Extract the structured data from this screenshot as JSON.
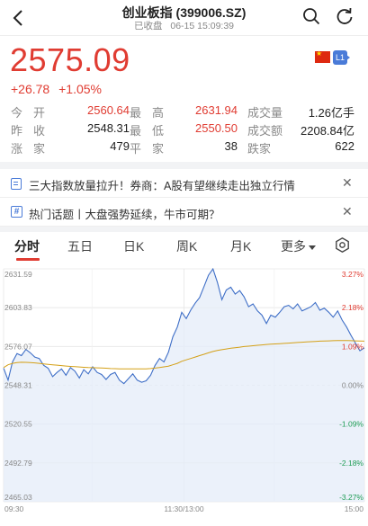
{
  "header": {
    "title": "创业板指 (399006.SZ)",
    "status": "已收盘",
    "datetime": "06-15 15:09:39"
  },
  "quote": {
    "price": "2575.09",
    "change": "+26.78",
    "change_pct": "+1.05%",
    "badge": "L1"
  },
  "stats": [
    [
      {
        "label": "今开",
        "value": "2560.64",
        "color": "red"
      },
      {
        "label": "最高",
        "value": "2631.94",
        "color": "red"
      },
      {
        "label": "成交量",
        "value": "1.26亿手",
        "color": "normal"
      }
    ],
    [
      {
        "label": "昨收",
        "value": "2548.31",
        "color": "normal"
      },
      {
        "label": "最低",
        "value": "2550.50",
        "color": "red"
      },
      {
        "label": "成交额",
        "value": "2208.84亿",
        "color": "normal"
      }
    ],
    [
      {
        "label": "涨家",
        "value": "479",
        "color": "normal"
      },
      {
        "label": "平家",
        "value": "38",
        "color": "normal"
      },
      {
        "label": "跌家",
        "value": "622",
        "color": "normal"
      }
    ]
  ],
  "news": [
    {
      "text": "三大指数放量拉升！券商：A股有望继续走出独立行情"
    },
    {
      "text": "热门话题丨大盘强势延续，牛市可期？"
    }
  ],
  "tabs": [
    "分时",
    "五日",
    "日K",
    "周K",
    "月K",
    "更多"
  ],
  "active_tab": "分时",
  "colors": {
    "up": "#e03c32",
    "down": "#1f9d55",
    "line": "#3f6fc7",
    "avg": "#d4a017",
    "fill": "#e4ecf8"
  },
  "chart_data": {
    "type": "line",
    "y_left_ticks": [
      "2631.59",
      "2603.83",
      "2576.07",
      "2548.31",
      "2520.55",
      "2492.79",
      "2465.03"
    ],
    "y_right_ticks": [
      "3.27%",
      "2.18%",
      "1.09%",
      "0.00%",
      "-1.09%",
      "-2.18%",
      "-3.27%"
    ],
    "x_ticks": [
      "09:30",
      "11:30/13:00",
      "15:00"
    ],
    "ylim": [
      2465.03,
      2631.59
    ],
    "prev_close": 2548.31,
    "series": [
      {
        "values": [
          2560.6,
          2552.0,
          2565.0,
          2571.0,
          2569.5,
          2574.0,
          2571.5,
          2568.5,
          2567.5,
          2562.5,
          2560.5,
          2554.5,
          2557.5,
          2560.0,
          2555.5,
          2561.0,
          2558.5,
          2553.5,
          2559.5,
          2556.5,
          2561.5,
          2557.5,
          2556.0,
          2552.5,
          2556.0,
          2557.5,
          2552.0,
          2549.5,
          2553.0,
          2556.5,
          2552.0,
          2550.5,
          2551.5,
          2555.5,
          2562.5,
          2567.5,
          2565.0,
          2572.0,
          2583.0,
          2590.0,
          2600.5,
          2596.0,
          2602.0,
          2607.0,
          2611.0,
          2619.0,
          2627.0,
          2631.5,
          2622.0,
          2609.5,
          2616.5,
          2618.5,
          2613.5,
          2616.0,
          2611.5,
          2604.5,
          2606.5,
          2601.5,
          2598.5,
          2592.5,
          2598.5,
          2597.0,
          2600.5,
          2604.5,
          2605.5,
          2603.0,
          2606.5,
          2601.5,
          2603.0,
          2604.5,
          2607.5,
          2602.0,
          2603.5,
          2600.5,
          2597.0,
          2601.5,
          2595.0,
          2590.0,
          2584.0,
          2578.5,
          2573.0,
          2575.1
        ]
      },
      {
        "values": [
          2561,
          2563,
          2564,
          2564.5,
          2564.8,
          2564.7,
          2564.5,
          2564.3,
          2564.0,
          2563.6,
          2563.3,
          2563.0,
          2562.7,
          2562.4,
          2562.1,
          2561.8,
          2561.6,
          2561.4,
          2561.2,
          2561.0,
          2560.9,
          2560.8,
          2560.7,
          2560.5,
          2560.3,
          2560.2,
          2560.1,
          2560.0,
          2560.0,
          2560.0,
          2560.0,
          2560.0,
          2560.1,
          2560.3,
          2560.6,
          2561.0,
          2561.5,
          2562.0,
          2563.0,
          2564.0,
          2565.5,
          2566.5,
          2567.5,
          2568.5,
          2569.5,
          2570.5,
          2571.5,
          2572.5,
          2573.2,
          2573.8,
          2574.3,
          2574.8,
          2575.2,
          2575.6,
          2576.0,
          2576.3,
          2576.6,
          2576.9,
          2577.2,
          2577.5,
          2577.7,
          2577.9,
          2578.1,
          2578.3,
          2578.5,
          2578.7,
          2578.9,
          2579.1,
          2579.3,
          2579.5,
          2579.7,
          2579.9,
          2580.0,
          2580.1,
          2580.2,
          2580.3,
          2580.3,
          2580.3,
          2580.2,
          2580.1,
          2580.0,
          2579.9
        ]
      }
    ]
  }
}
